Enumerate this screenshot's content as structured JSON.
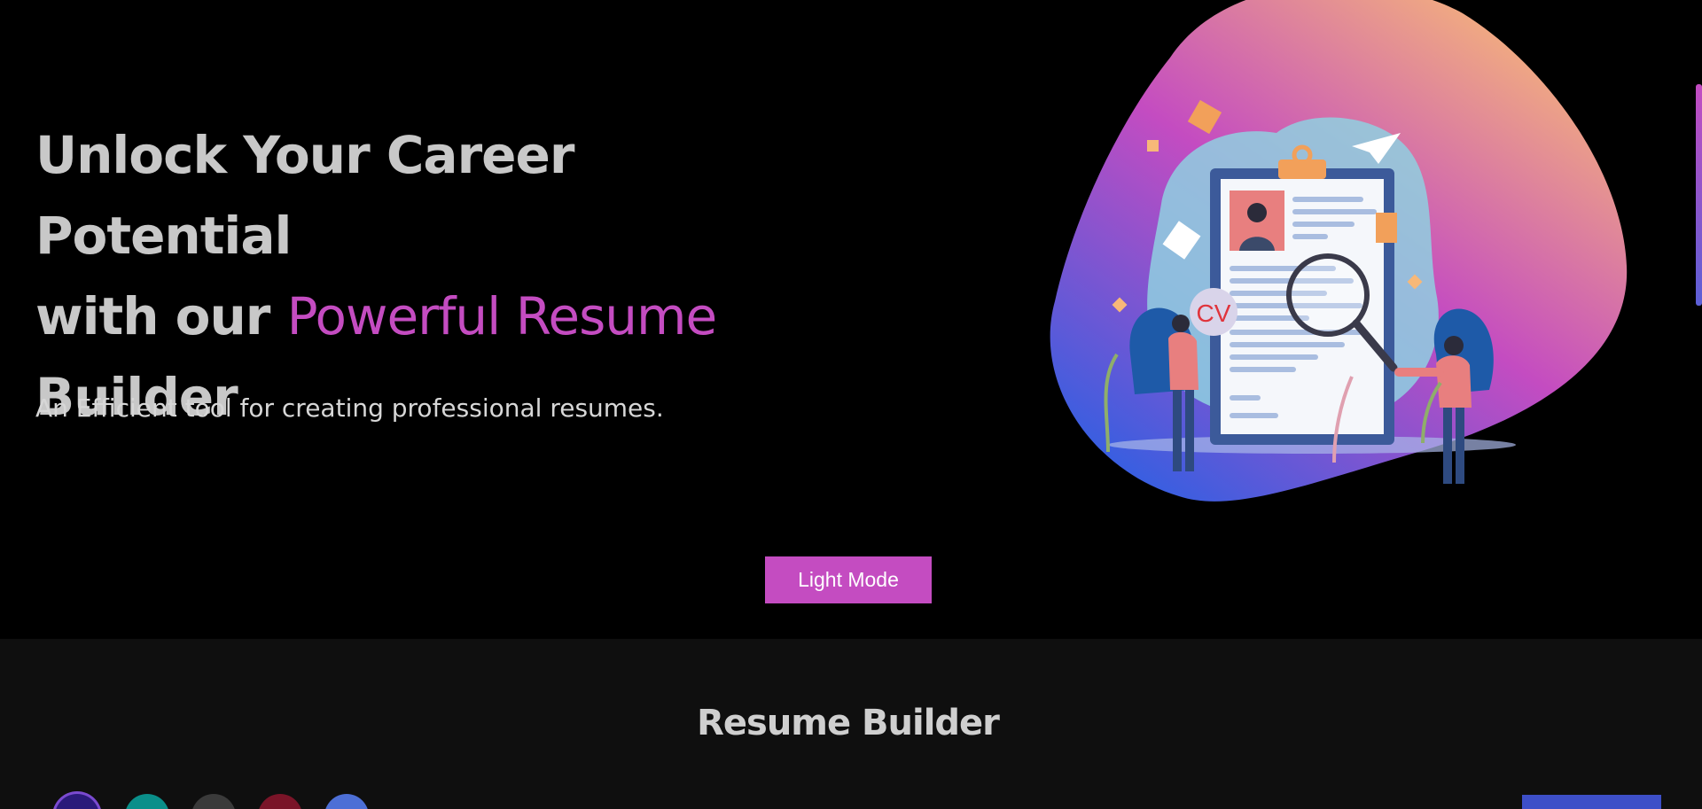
{
  "hero": {
    "title_line1": "Unlock Your Career Potential",
    "title_with": "with our ",
    "title_accent": "Powerful Resume",
    "title_line3": "Builder",
    "subtitle": "An Efficient tool for creating professional resumes.",
    "illustration_cv_label": "CV",
    "mode_button_label": "Light Mode"
  },
  "builder": {
    "title": "Resume Builder",
    "swatches": [
      {
        "name": "indigo",
        "color": "#2a1a7a",
        "selected": true
      },
      {
        "name": "teal",
        "color": "#0a8f8a",
        "selected": false
      },
      {
        "name": "dark-gray",
        "color": "#3a3a3a",
        "selected": false
      },
      {
        "name": "maroon",
        "color": "#7a1428",
        "selected": false
      },
      {
        "name": "blue",
        "color": "#4d6fd6",
        "selected": false
      }
    ]
  },
  "colors": {
    "accent": "#c44cc1",
    "background": "#000000",
    "section_background": "#0f0f0f",
    "heading_text": "#c8c8c8",
    "action_blue": "#3d4fc8"
  }
}
